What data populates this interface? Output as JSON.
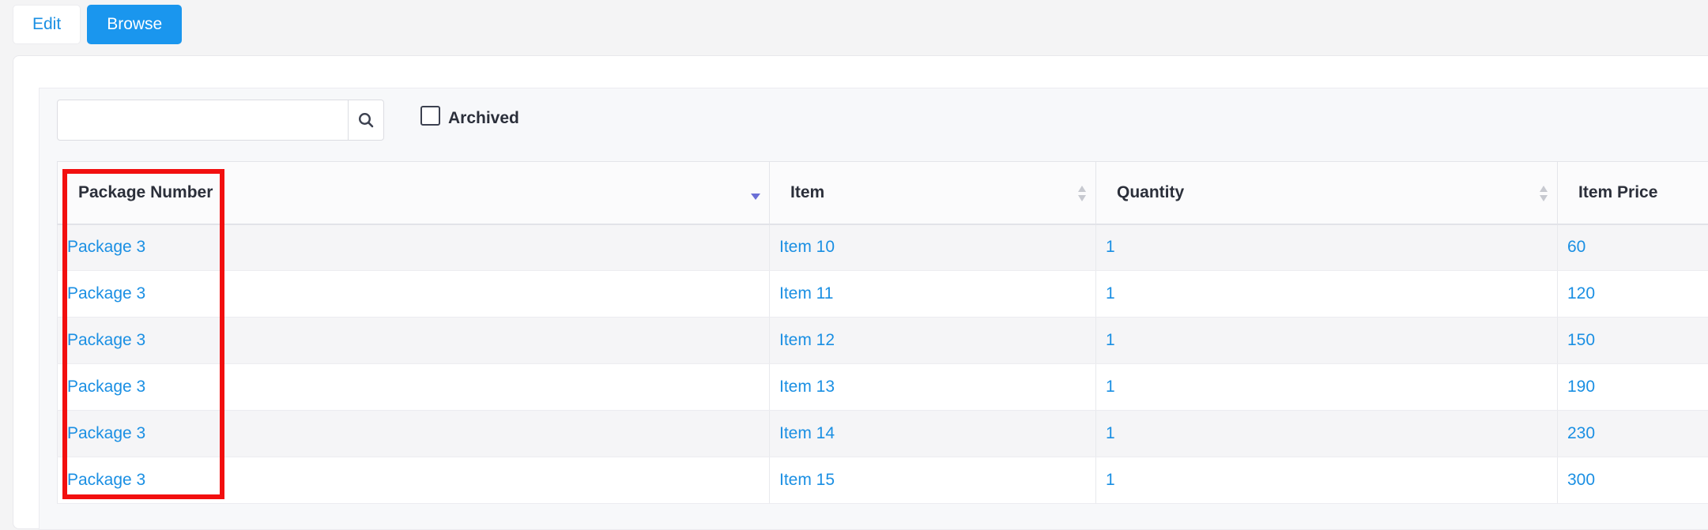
{
  "view_toggle": {
    "edit_label": "Edit",
    "browse_label": "Browse"
  },
  "toolbar": {
    "search_placeholder": "",
    "archived_label": "Archived"
  },
  "table": {
    "columns": [
      "Package Number",
      "Item",
      "Quantity",
      "Item Price"
    ],
    "rows": [
      [
        "Package 3",
        "Item 10",
        "1",
        "60"
      ],
      [
        "Package 3",
        "Item 11",
        "1",
        "120"
      ],
      [
        "Package 3",
        "Item 12",
        "1",
        "150"
      ],
      [
        "Package 3",
        "Item 13",
        "1",
        "190"
      ],
      [
        "Package 3",
        "Item 14",
        "1",
        "230"
      ],
      [
        "Package 3",
        "Item 15",
        "1",
        "300"
      ]
    ]
  },
  "colors": {
    "accent": "#1a96ee",
    "link": "#1a8fe3",
    "highlight": "#f20f0f"
  },
  "icons": {
    "search": "search-icon",
    "sort_active": "sort-desc-icon",
    "sort_inactive": "sort-both-icon"
  }
}
